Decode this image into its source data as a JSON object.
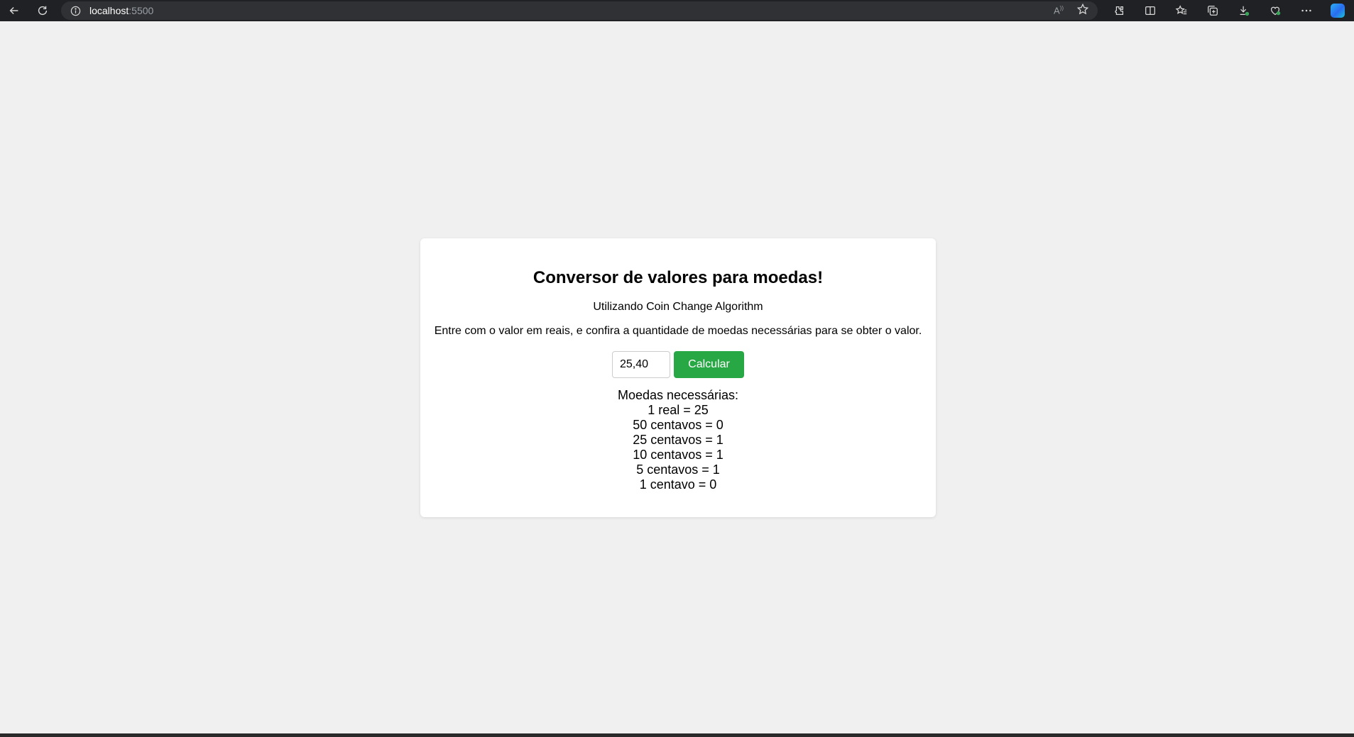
{
  "browser": {
    "url_host": "localhost",
    "url_port": ":5500"
  },
  "page": {
    "title": "Conversor de valores para moedas!",
    "subtitle": "Utilizando Coin Change Algorithm",
    "instructions": "Entre com o valor em reais, e confira a quantidade de moedas necessárias para se obter o valor.",
    "input_value": "25,40",
    "button_label": "Calcular",
    "result_header": "Moedas necessárias:",
    "results": [
      "1 real = 25",
      "50 centavos = 0",
      "25 centavos = 1",
      "10 centavos = 1",
      "5 centavos = 1",
      "1 centavo = 0"
    ]
  },
  "colors": {
    "button": "#28a745",
    "page_background": "#f0f0f0",
    "browser_bar": "#202124"
  },
  "icons": {
    "nav": [
      "back-arrow-icon",
      "refresh-icon",
      "site-info-icon"
    ],
    "address_bar": [
      "read-aloud-icon",
      "favorite-star-icon"
    ],
    "toolbar": [
      "extensions-icon",
      "split-screen-icon",
      "favorites-icon",
      "collections-icon",
      "downloads-icon",
      "browser-essentials-icon",
      "more-options-icon",
      "copilot-icon"
    ]
  }
}
